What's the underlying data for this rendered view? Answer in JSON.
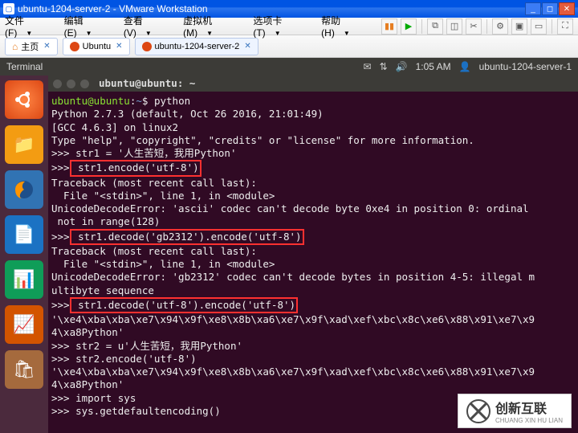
{
  "window": {
    "title": "ubuntu-1204-server-2 - VMware Workstation"
  },
  "menubar": {
    "file": "文件(F)",
    "edit": "编辑(E)",
    "view": "查看(V)",
    "vm": "虚拟机(M)",
    "tabs": "选项卡(T)",
    "help": "帮助(H)"
  },
  "tabs": {
    "home": "主页",
    "t1": "Ubuntu",
    "t2": "ubuntu-1204-server-2"
  },
  "ubuntu_top": {
    "left": "Terminal",
    "time": "1:05 AM",
    "user": "ubuntu-1204-server-1"
  },
  "term_title": "ubuntu@ubuntu: ~",
  "prompt_user": "ubuntu@ubuntu",
  "prompt_path": "~",
  "prompt_sym": "$",
  "lines": {
    "l1_cmd": " python",
    "l2": "Python 2.7.3 (default, Oct 26 2016, 21:01:49)",
    "l3": "[GCC 4.6.3] on linux2",
    "l4": "Type \"help\", \"copyright\", \"credits\" or \"license\" for more information.",
    "l5": ">>> str1 = '人生苦短，我用Python'",
    "l6a": ">>>",
    "l6b": " str1.encode('utf-8')",
    "l7": "Traceback (most recent call last):",
    "l8": "  File \"<stdin>\", line 1, in <module>",
    "l9a": "UnicodeDecodeError: 'ascii' codec can't decode byte 0xe4 in position 0: ordinal",
    "l9b": " not in range(128)",
    "l10a": ">>>",
    "l10b": " str1.decode('gb2312').encode('utf-8')",
    "l11": "Traceback (most recent call last):",
    "l12": "  File \"<stdin>\", line 1, in <module>",
    "l13a": "UnicodeDecodeError: 'gb2312' codec can't decode bytes in position 4-5: illegal m",
    "l13b": "ultibyte sequence",
    "l14a": ">>>",
    "l14b": " str1.decode('utf-8').encode('utf-8')",
    "l15a": "'\\xe4\\xba\\xba\\xe7\\x94\\x9f\\xe8\\x8b\\xa6\\xe7\\x9f\\xad\\xef\\xbc\\x8c\\xe6\\x88\\x91\\xe7\\x9",
    "l15b": "4\\xa8Python'",
    "l16": ">>> str2 = u'人生苦短，我用Python'",
    "l17": ">>> str2.encode('utf-8')",
    "l18a": "'\\xe4\\xba\\xba\\xe7\\x94\\x9f\\xe8\\x8b\\xa6\\xe7\\x9f\\xad\\xef\\xbc\\x8c\\xe6\\x88\\x91\\xe7\\x9",
    "l18b": "4\\xa8Python'",
    "l19": ">>> import sys",
    "l20": ">>> sys.getdefaultencoding()"
  },
  "watermark": {
    "main": "创新互联",
    "sub": "CHUANG XIN HU LIAN"
  }
}
